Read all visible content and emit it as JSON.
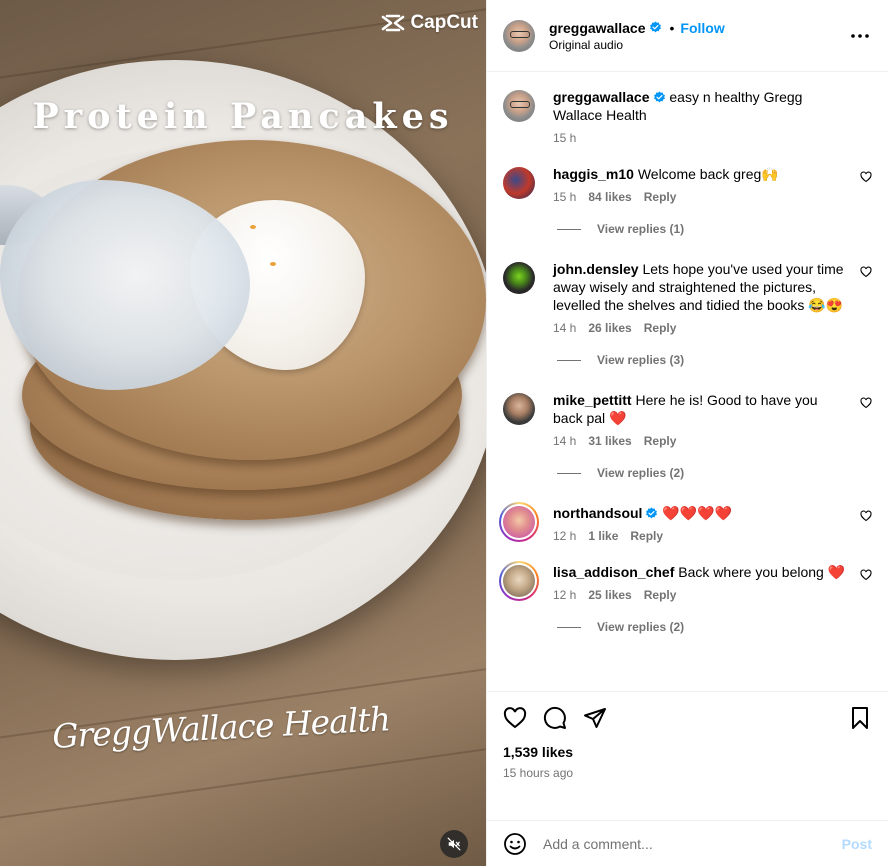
{
  "video": {
    "title": "Protein Pancakes",
    "watermark": "CapCut",
    "signature": "GreggWallace Health",
    "icons": {
      "watermark_logo": "capcut-logo-icon",
      "mute": "speaker-muted-icon"
    }
  },
  "header": {
    "username": "greggawallace",
    "follow_label": "Follow",
    "separator": "•",
    "audio": "Original audio",
    "icons": {
      "verified": "verified-badge-icon",
      "more": "more-options-icon"
    }
  },
  "caption": {
    "username": "greggawallace",
    "text": "easy n healthy Gregg Wallace Health",
    "time": "15 h"
  },
  "comments": [
    {
      "username": "haggis_m10",
      "text": "Welcome back greg🙌",
      "time": "15 h",
      "likes": "84 likes",
      "reply": "Reply",
      "view_replies": "View replies (1)"
    },
    {
      "username": "john.densley",
      "text": "Lets hope you've used your time away wisely and straightened the pictures, levelled the shelves and tidied the books 😂😍",
      "time": "14 h",
      "likes": "26 likes",
      "reply": "Reply",
      "view_replies": "View replies (3)"
    },
    {
      "username": "mike_pettitt",
      "text": "Here he is! Good to have you back pal ❤️",
      "time": "14 h",
      "likes": "31 likes",
      "reply": "Reply",
      "view_replies": "View replies (2)"
    },
    {
      "username": "northandsoul",
      "verified": true,
      "text": "❤️❤️❤️❤️",
      "time": "12 h",
      "likes": "1 like",
      "reply": "Reply"
    },
    {
      "username": "lisa_addison_chef",
      "text": "Back where you belong ❤️",
      "time": "12 h",
      "likes": "25 likes",
      "reply": "Reply",
      "view_replies": "View replies (2)"
    }
  ],
  "actions": {
    "likes": "1,539 likes",
    "time_ago": "15 hours ago",
    "icons": [
      "heart-icon",
      "comment-icon",
      "share-icon",
      "bookmark-icon"
    ]
  },
  "comment_box": {
    "placeholder": "Add a comment...",
    "post_label": "Post",
    "icons": {
      "emoji": "emoji-icon"
    }
  },
  "colors": {
    "accent": "#0095f6",
    "muted_text": "#737373",
    "post_disabled": "#b3dbff",
    "heart_red": "#ed4956"
  }
}
